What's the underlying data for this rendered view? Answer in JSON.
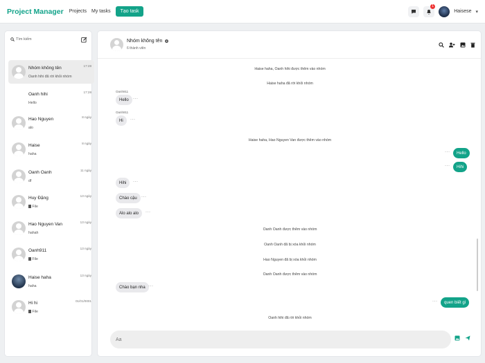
{
  "nav": {
    "brand": "Project Manager",
    "links": [
      "Projects",
      "My tasks"
    ],
    "create_task": "Tạo task",
    "notification_count": "1",
    "user_name": "Haisese",
    "accent": "#13a389"
  },
  "sidebar": {
    "search_label": "Tìm kiếm",
    "conversations": [
      {
        "name": "Nhóm không tên",
        "last": "Oanh hihi đã rời khỏi nhóm",
        "time": "17:28",
        "avatar": "default",
        "active": true
      },
      {
        "name": "Oanh hihi",
        "last": "Hello",
        "time": "17:28",
        "avatar": "none"
      },
      {
        "name": "Hao Nguyen",
        "last": "alo",
        "time": "8 ngày",
        "avatar": "default"
      },
      {
        "name": "Haise",
        "last": "haha",
        "time": "8 ngày",
        "avatar": "default"
      },
      {
        "name": "Oanh Oanh",
        "last": "df",
        "time": "11 ngày",
        "avatar": "default"
      },
      {
        "name": "Huy Đặng",
        "last": "File",
        "time": "13 ngày",
        "avatar": "default",
        "file": true
      },
      {
        "name": "Hao Nguyen Van",
        "last": "hahah",
        "time": "13 ngày",
        "avatar": "default"
      },
      {
        "name": "Oanh911",
        "last": "File",
        "time": "13 ngày",
        "avatar": "default",
        "file": true
      },
      {
        "name": "Haise haha",
        "last": "haha",
        "time": "13 ngày",
        "avatar": "photo"
      },
      {
        "name": "Hi hi",
        "last": "File",
        "time": "01/01/0001",
        "avatar": "default",
        "file": true
      }
    ]
  },
  "chat": {
    "title": "Nhóm không tên",
    "members": "6 thành viên",
    "messages": [
      {
        "kind": "system",
        "text": "Haise haha, Oanh hihi được thêm vào nhóm"
      },
      {
        "kind": "system",
        "text": "Haise haha đã rời khỏi nhóm"
      },
      {
        "kind": "in",
        "sender": "Oanh911",
        "text": "Hello"
      },
      {
        "kind": "in",
        "sender": "Oanh911",
        "text": "Hi"
      },
      {
        "kind": "system",
        "text": "Haise haha, Hao Nguyen Van được thêm vào nhóm"
      },
      {
        "kind": "out",
        "text": "Hello"
      },
      {
        "kind": "out",
        "text": "Hihi"
      },
      {
        "kind": "in",
        "text": "Hihi"
      },
      {
        "kind": "in",
        "text": "Chào cậu"
      },
      {
        "kind": "in",
        "text": "Alo alo alo"
      },
      {
        "kind": "system",
        "text": "Oanh Oanh được thêm vào nhóm"
      },
      {
        "kind": "system",
        "text": "Oanh Oanh đã bị xóa khỏi nhóm"
      },
      {
        "kind": "system",
        "text": "Hao Nguyen đã bị xóa khỏi nhóm"
      },
      {
        "kind": "system",
        "text": "Oanh Oanh được thêm vào nhóm"
      },
      {
        "kind": "in",
        "text": "Chào bạn nha"
      },
      {
        "kind": "out",
        "text": "quen biết gì"
      },
      {
        "kind": "system",
        "text": "Oanh hihi đã rời khỏi nhóm"
      }
    ],
    "dots": "···",
    "composer_placeholder": "Aa"
  }
}
